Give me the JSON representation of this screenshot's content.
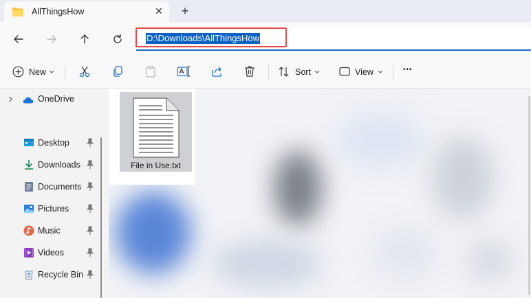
{
  "tab": {
    "title": "AllThingsHow",
    "close_glyph": "✕",
    "new_glyph": "+"
  },
  "address": {
    "path": "D:\\Downloads\\AllThingsHow",
    "highlight_color": "#e94b4b",
    "selection_color": "#0b62c4"
  },
  "toolbar": {
    "new_label": "New",
    "sort_label": "Sort",
    "view_label": "View",
    "more_glyph": "•••"
  },
  "sidebar": {
    "onedrive": "OneDrive",
    "items": [
      {
        "label": "Desktop",
        "icon": "desktop-icon"
      },
      {
        "label": "Downloads",
        "icon": "downloads-icon"
      },
      {
        "label": "Documents",
        "icon": "documents-icon"
      },
      {
        "label": "Pictures",
        "icon": "pictures-icon"
      },
      {
        "label": "Music",
        "icon": "music-icon"
      },
      {
        "label": "Videos",
        "icon": "videos-icon"
      },
      {
        "label": "Recycle Bin",
        "icon": "recycle-bin-icon"
      }
    ]
  },
  "files": [
    {
      "name": "File in Use.txt",
      "icon": "text-file-icon"
    }
  ]
}
